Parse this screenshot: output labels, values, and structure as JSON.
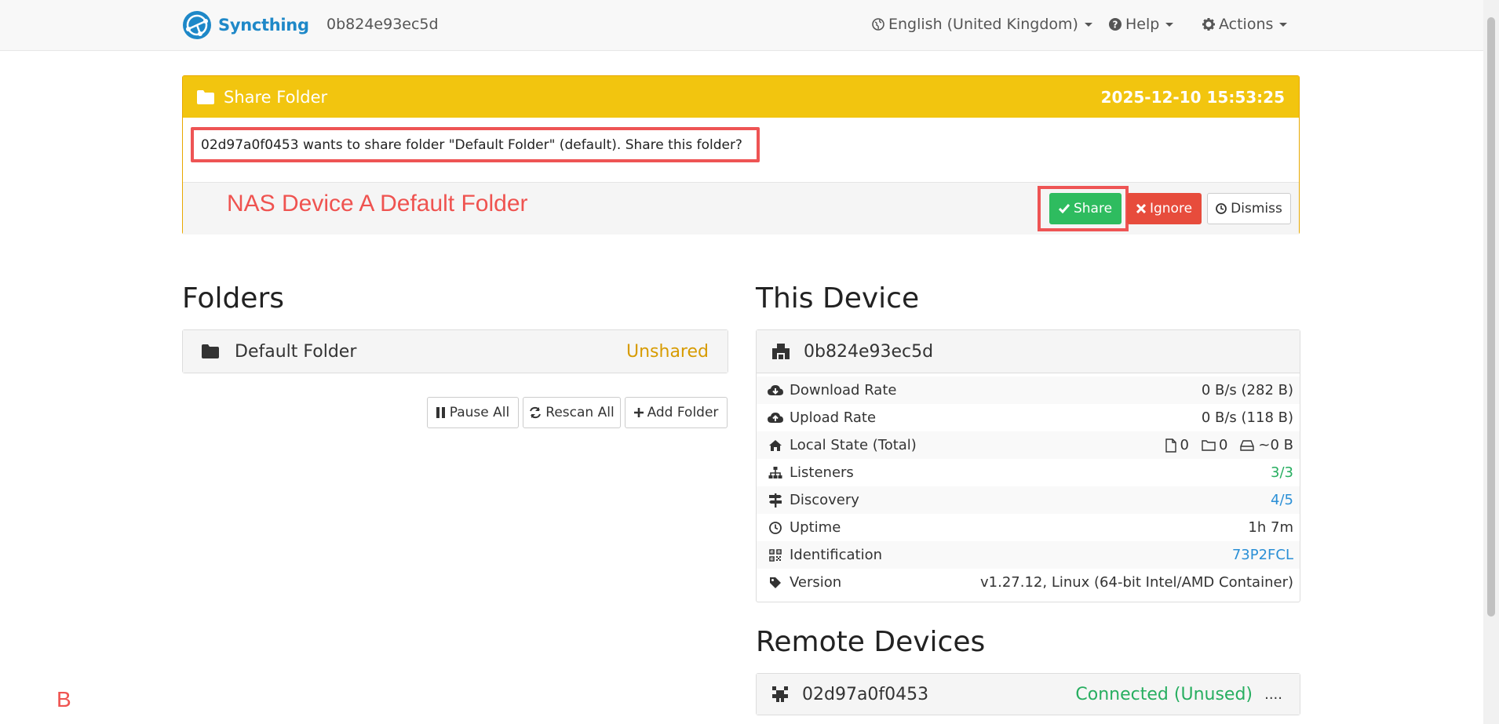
{
  "navbar": {
    "brand": "Syncthing",
    "device_name": "0b824e93ec5d",
    "language": "English (United Kingdom)",
    "help": "Help",
    "actions": "Actions"
  },
  "notice": {
    "title": "Share Folder",
    "timestamp": "2025-12-10 15:53:25",
    "message": "02d97a0f0453 wants to share folder \"Default Folder\" (default). Share this folder?",
    "annotation": "NAS Device A Default Folder",
    "share_label": "Share",
    "ignore_label": "Ignore",
    "dismiss_label": "Dismiss"
  },
  "folders": {
    "heading": "Folders",
    "items": [
      {
        "name": "Default Folder",
        "status": "Unshared"
      }
    ],
    "pause_all": "Pause All",
    "rescan_all": "Rescan All",
    "add_folder": "Add Folder"
  },
  "this_device": {
    "heading": "This Device",
    "name": "0b824e93ec5d",
    "rows": [
      {
        "label": "Download Rate",
        "value": "0 B/s (282 B)",
        "icon": "cloud-download-icon"
      },
      {
        "label": "Upload Rate",
        "value": "0 B/s (118 B)",
        "icon": "cloud-upload-icon"
      },
      {
        "label": "Local State (Total)",
        "icon": "home-icon"
      },
      {
        "label": "Listeners",
        "value": "3/3",
        "icon": "sitemap-icon"
      },
      {
        "label": "Discovery",
        "value": "4/5",
        "icon": "signpost-icon"
      },
      {
        "label": "Uptime",
        "value": "1h 7m",
        "icon": "clock-icon"
      },
      {
        "label": "Identification",
        "value": "73P2FCL",
        "icon": "qrcode-icon"
      },
      {
        "label": "Version",
        "value": "v1.27.12, Linux (64-bit Intel/AMD Container)",
        "icon": "tag-icon"
      }
    ],
    "local_state": {
      "files": "0",
      "dirs": "0",
      "size": "~0 B"
    }
  },
  "remote_devices": {
    "heading": "Remote Devices",
    "items": [
      {
        "name": "02d97a0f0453",
        "status": "Connected (Unused)",
        "more": "...."
      }
    ]
  },
  "annotations": {
    "b": "B"
  },
  "colors": {
    "brand": "#1e88c8",
    "warning": "#f2c50f",
    "success": "#2ebc5f",
    "danger": "#e74c3c",
    "unshared": "#d79b00",
    "link": "#2a8fd6",
    "annotation": "#ef5350"
  }
}
